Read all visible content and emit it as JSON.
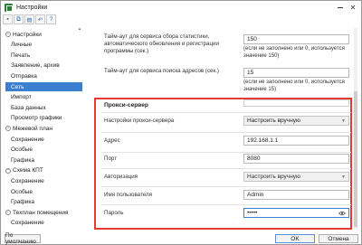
{
  "window": {
    "title": "Настройки"
  },
  "toolbar": {
    "buttons": [
      "save-icon",
      "copy-icon",
      "paste-icon",
      "undo-icon",
      "question-icon"
    ]
  },
  "sidebar": {
    "items": [
      {
        "label": "Настройки",
        "kind": "group",
        "toggle": "−"
      },
      {
        "label": "Личные",
        "kind": "item"
      },
      {
        "label": "Печать",
        "kind": "item"
      },
      {
        "label": "Заявление, архив",
        "kind": "item"
      },
      {
        "label": "Отправка",
        "kind": "item"
      },
      {
        "label": "Сеть",
        "kind": "selected"
      },
      {
        "label": "Импорт",
        "kind": "item"
      },
      {
        "label": "База данных",
        "kind": "item"
      },
      {
        "label": "Просмотр графики",
        "kind": "item"
      },
      {
        "label": "Межевой план",
        "kind": "group",
        "toggle": "−"
      },
      {
        "label": "Сохранение",
        "kind": "item"
      },
      {
        "label": "Особые",
        "kind": "item"
      },
      {
        "label": "Графика",
        "kind": "item"
      },
      {
        "label": "Схема КПТ",
        "kind": "group",
        "toggle": "−"
      },
      {
        "label": "Сохранение",
        "kind": "item"
      },
      {
        "label": "Особые",
        "kind": "item"
      },
      {
        "label": "Графика",
        "kind": "item"
      },
      {
        "label": "Техплан помещения",
        "kind": "group",
        "toggle": "−"
      },
      {
        "label": "Сохранение",
        "kind": "item"
      }
    ]
  },
  "main": {
    "stats_timeout": {
      "label": "Тайм-аут для сервиса сбора статистики, автоматического обновления и регистрации программы (сек.)",
      "value": "150",
      "hint": "(если не заполнено или 0, используется значение 150)"
    },
    "address_timeout": {
      "label": "Тайм-аут для сервиса поиска адресов (сек.)",
      "value": "15",
      "hint": "(если не заполнено или 0, используется значение 15)"
    },
    "proxy": {
      "title": "Прокси-сервер",
      "settings_label": "Настройки прокси-сервера",
      "settings_value": "Настроить вручную",
      "address_label": "Адрес",
      "address_value": "192.168.1.1",
      "port_label": "Порт",
      "port_value": "8080",
      "auth_label": "Авторизация",
      "auth_value": "Настроить вручную",
      "user_label": "Имя пользователя",
      "user_value": "Admin",
      "password_label": "Пароль",
      "password_value": "•••••"
    }
  },
  "footer": {
    "default_label": "По умолчанию",
    "ok_label": "OK",
    "cancel_label": "Отмена"
  },
  "colors": {
    "selection": "#3a7fd0",
    "highlight_border": "#e53935",
    "brand": "#2e7d32"
  }
}
